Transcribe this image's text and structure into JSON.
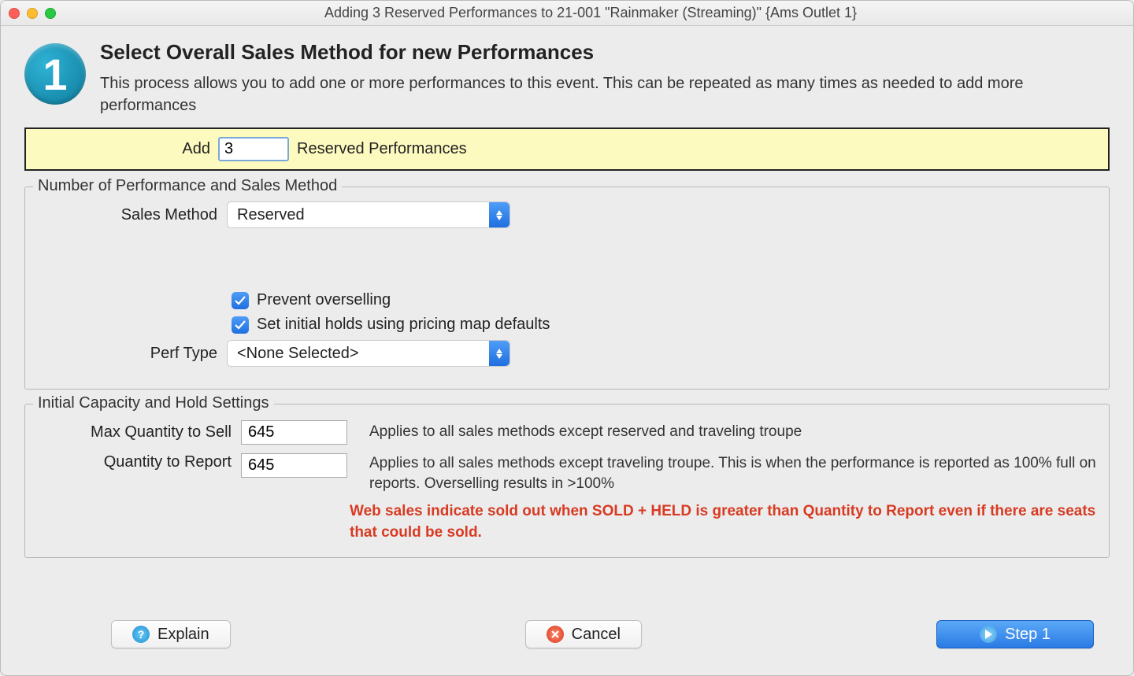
{
  "window": {
    "title": "Adding 3 Reserved Performances to 21-001 \"Rainmaker (Streaming)\" {Ams Outlet 1}"
  },
  "step": {
    "number": "1"
  },
  "header": {
    "title": "Select Overall Sales Method for new Performances",
    "description": "This process allows you to add one or more performances to this event.  This can be repeated as many times as needed to add more performances"
  },
  "addbar": {
    "prefix": "Add",
    "value": "3",
    "suffix": "Reserved Performances"
  },
  "fs1": {
    "legend": "Number of Performance and Sales Method",
    "sales_method_label": "Sales Method",
    "sales_method_value": "Reserved",
    "cb1_label": "Prevent overselling",
    "cb2_label": "Set initial holds using pricing map defaults",
    "perf_type_label": "Perf Type",
    "perf_type_value": "<None Selected>"
  },
  "fs2": {
    "legend": "Initial Capacity and Hold Settings",
    "max_qty_label": "Max Quantity to Sell",
    "max_qty_value": "645",
    "max_qty_desc": "Applies to all sales methods except reserved and traveling troupe",
    "rep_qty_label": "Quantity to Report",
    "rep_qty_value": "645",
    "rep_qty_desc": "Applies to all sales methods except traveling troupe. This is when the performance is reported as 100% full on reports.  Overselling results in >100%",
    "red_note": "Web sales indicate sold out when SOLD + HELD is greater than Quantity to Report even if there are seats that could be sold."
  },
  "buttons": {
    "explain": "Explain",
    "cancel": "Cancel",
    "step1": "Step 1"
  }
}
